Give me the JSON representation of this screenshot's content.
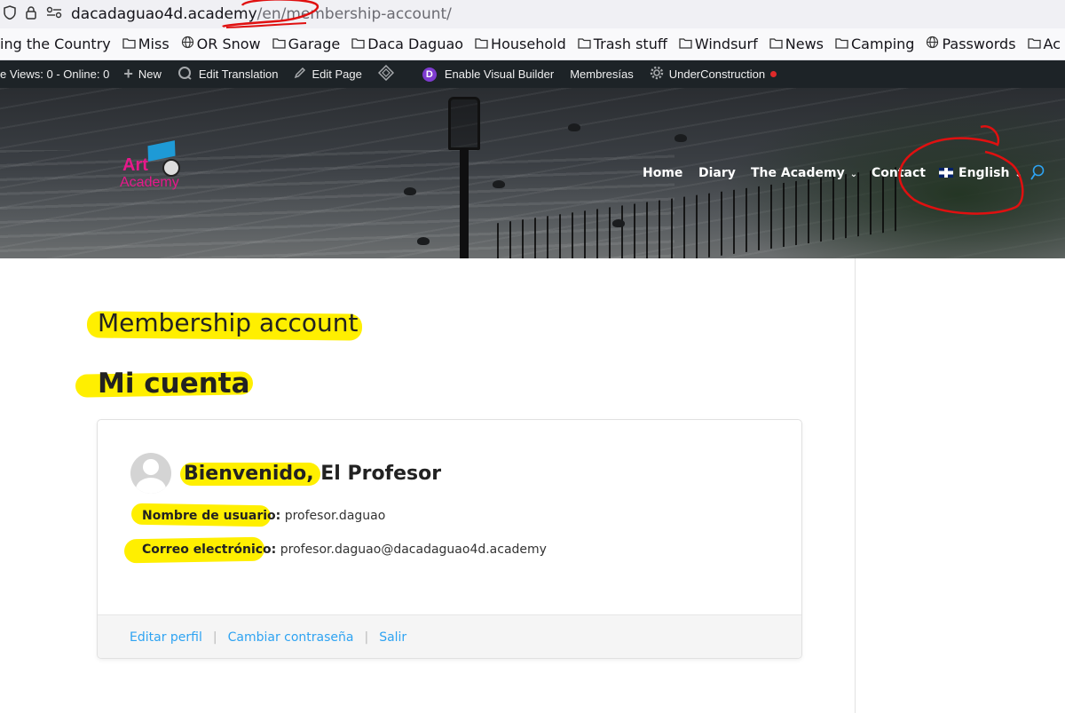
{
  "browser": {
    "url_host": "dacadaguao4d.academy",
    "url_path": "/en/membership-account/",
    "icons": [
      "shield-icon",
      "lock-icon",
      "site-settings-icon"
    ]
  },
  "bookmarks": [
    {
      "label": "ing the Country",
      "icon": "none"
    },
    {
      "label": "Miss",
      "icon": "folder-icon"
    },
    {
      "label": "OR Snow",
      "icon": "globe-icon"
    },
    {
      "label": "Garage",
      "icon": "folder-icon"
    },
    {
      "label": "Daca Daguao",
      "icon": "folder-icon"
    },
    {
      "label": "Household",
      "icon": "folder-icon"
    },
    {
      "label": "Trash stuff",
      "icon": "folder-icon"
    },
    {
      "label": "Windsurf",
      "icon": "folder-icon"
    },
    {
      "label": "News",
      "icon": "folder-icon"
    },
    {
      "label": "Camping",
      "icon": "folder-icon"
    },
    {
      "label": "Passwords",
      "icon": "globe-icon"
    },
    {
      "label": "Ac",
      "icon": "folder-icon"
    }
  ],
  "adminbar": {
    "views": "e Views: 0 - Online: 0",
    "new": "New",
    "edit_translation": "Edit Translation",
    "edit_page": "Edit Page",
    "visual_builder": "Enable Visual Builder",
    "memberships": "Membresías",
    "under_construction": "UnderConstruction"
  },
  "header": {
    "logo_art": "Art",
    "logo_academy": "Academy",
    "nav": {
      "home": "Home",
      "diary": "Diary",
      "academy": "The Academy",
      "contact": "Contact",
      "language": "English"
    }
  },
  "content": {
    "page_title": "Membership account",
    "section_title": "Mi cuenta",
    "welcome": "Bienvenido, El Profesor",
    "username_label": "Nombre de usuario:",
    "username_value": "profesor.daguao",
    "email_label": "Correo electrónico:",
    "email_value": "profesor.daguao@dacadaguao4d.academy",
    "links": {
      "edit_profile": "Editar perfil",
      "change_password": "Cambiar contraseña",
      "logout": "Salir"
    }
  },
  "colors": {
    "highlight": "#ffef00",
    "annotation": "#e01010",
    "link": "#2ea3f2",
    "brand": "#e6198b"
  }
}
